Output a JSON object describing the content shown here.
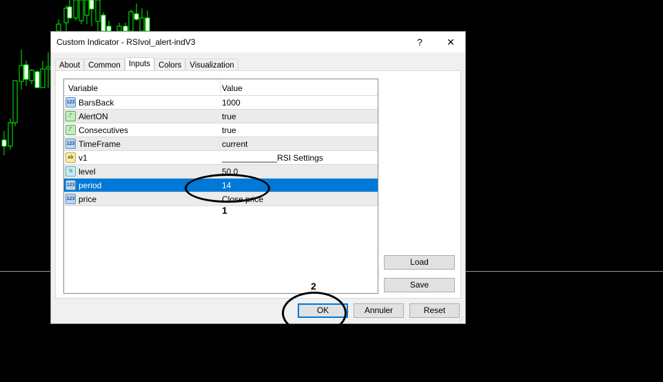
{
  "chart": {
    "candle_color": "#00ff00",
    "background": "#000000"
  },
  "dialog": {
    "title": "Custom Indicator - RSIvol_alert-indV3",
    "help_label": "?",
    "close_label": "✕",
    "tabs": [
      {
        "label": "About"
      },
      {
        "label": "Common"
      },
      {
        "label": "Inputs",
        "active": true
      },
      {
        "label": "Colors"
      },
      {
        "label": "Visualization"
      }
    ],
    "grid": {
      "headers": {
        "variable": "Variable",
        "value": "Value"
      },
      "rows": [
        {
          "type": "int",
          "icon_text": "123",
          "variable": "BarsBack",
          "value": "1000"
        },
        {
          "type": "bool",
          "icon_text": "⁄‾",
          "variable": "AlertON",
          "value": "true"
        },
        {
          "type": "bool",
          "icon_text": "⁄‾",
          "variable": "Consecutives",
          "value": "true"
        },
        {
          "type": "int",
          "icon_text": "123",
          "variable": "TimeFrame",
          "value": "current"
        },
        {
          "type": "str",
          "icon_text": "ab",
          "variable": "v1",
          "value": "____________RSI Settings"
        },
        {
          "type": "dbl",
          "icon_text": "½",
          "variable": "level",
          "value": "50.0"
        },
        {
          "type": "int",
          "icon_text": "123",
          "variable": "period",
          "value": "14",
          "selected": true
        },
        {
          "type": "int",
          "icon_text": "123",
          "variable": "price",
          "value": "Close price"
        }
      ]
    },
    "buttons": {
      "load": "Load",
      "save": "Save",
      "ok": "OK",
      "cancel": "Annuler",
      "reset": "Reset"
    },
    "selection_color": "#0078d7"
  },
  "annotations": {
    "mark1": "1",
    "mark2": "2"
  }
}
